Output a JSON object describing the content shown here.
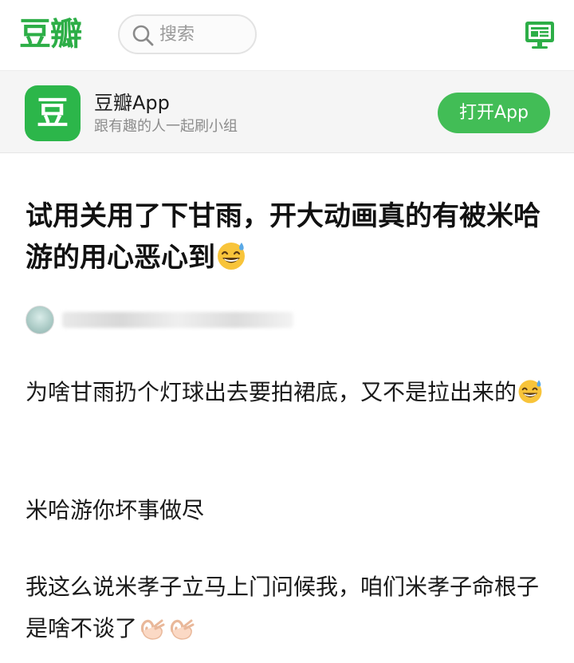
{
  "header": {
    "logo": "豆瓣",
    "search_placeholder": "搜索",
    "desktop_icon": "monitor-icon"
  },
  "banner": {
    "app_icon_text": "豆",
    "app_name": "豆瓣App",
    "slogan": "跟有趣的人一起刷小组",
    "open_button": "打开App"
  },
  "post": {
    "title": "试用关用了下甘雨，开大动画真的有被米哈游的用心恶心到",
    "title_emoji": "grinning-sweat-emoji",
    "author_name": "",
    "paragraphs": [
      {
        "text": "为啥甘雨扔个灯球出去要拍裙底，又不是拉出来的",
        "emoji": "grinning-sweat-emoji"
      },
      {
        "text": "米哈游你坏事做尽"
      },
      {
        "text": "我这么说米孝子立马上门问候我，咱们米孝子命根子是啥不谈了",
        "emoji": "ok-hand-emoji"
      }
    ]
  },
  "colors": {
    "brand_green": "#2dae47",
    "button_green": "#42bd56",
    "banner_bg": "#f5f5f5"
  }
}
